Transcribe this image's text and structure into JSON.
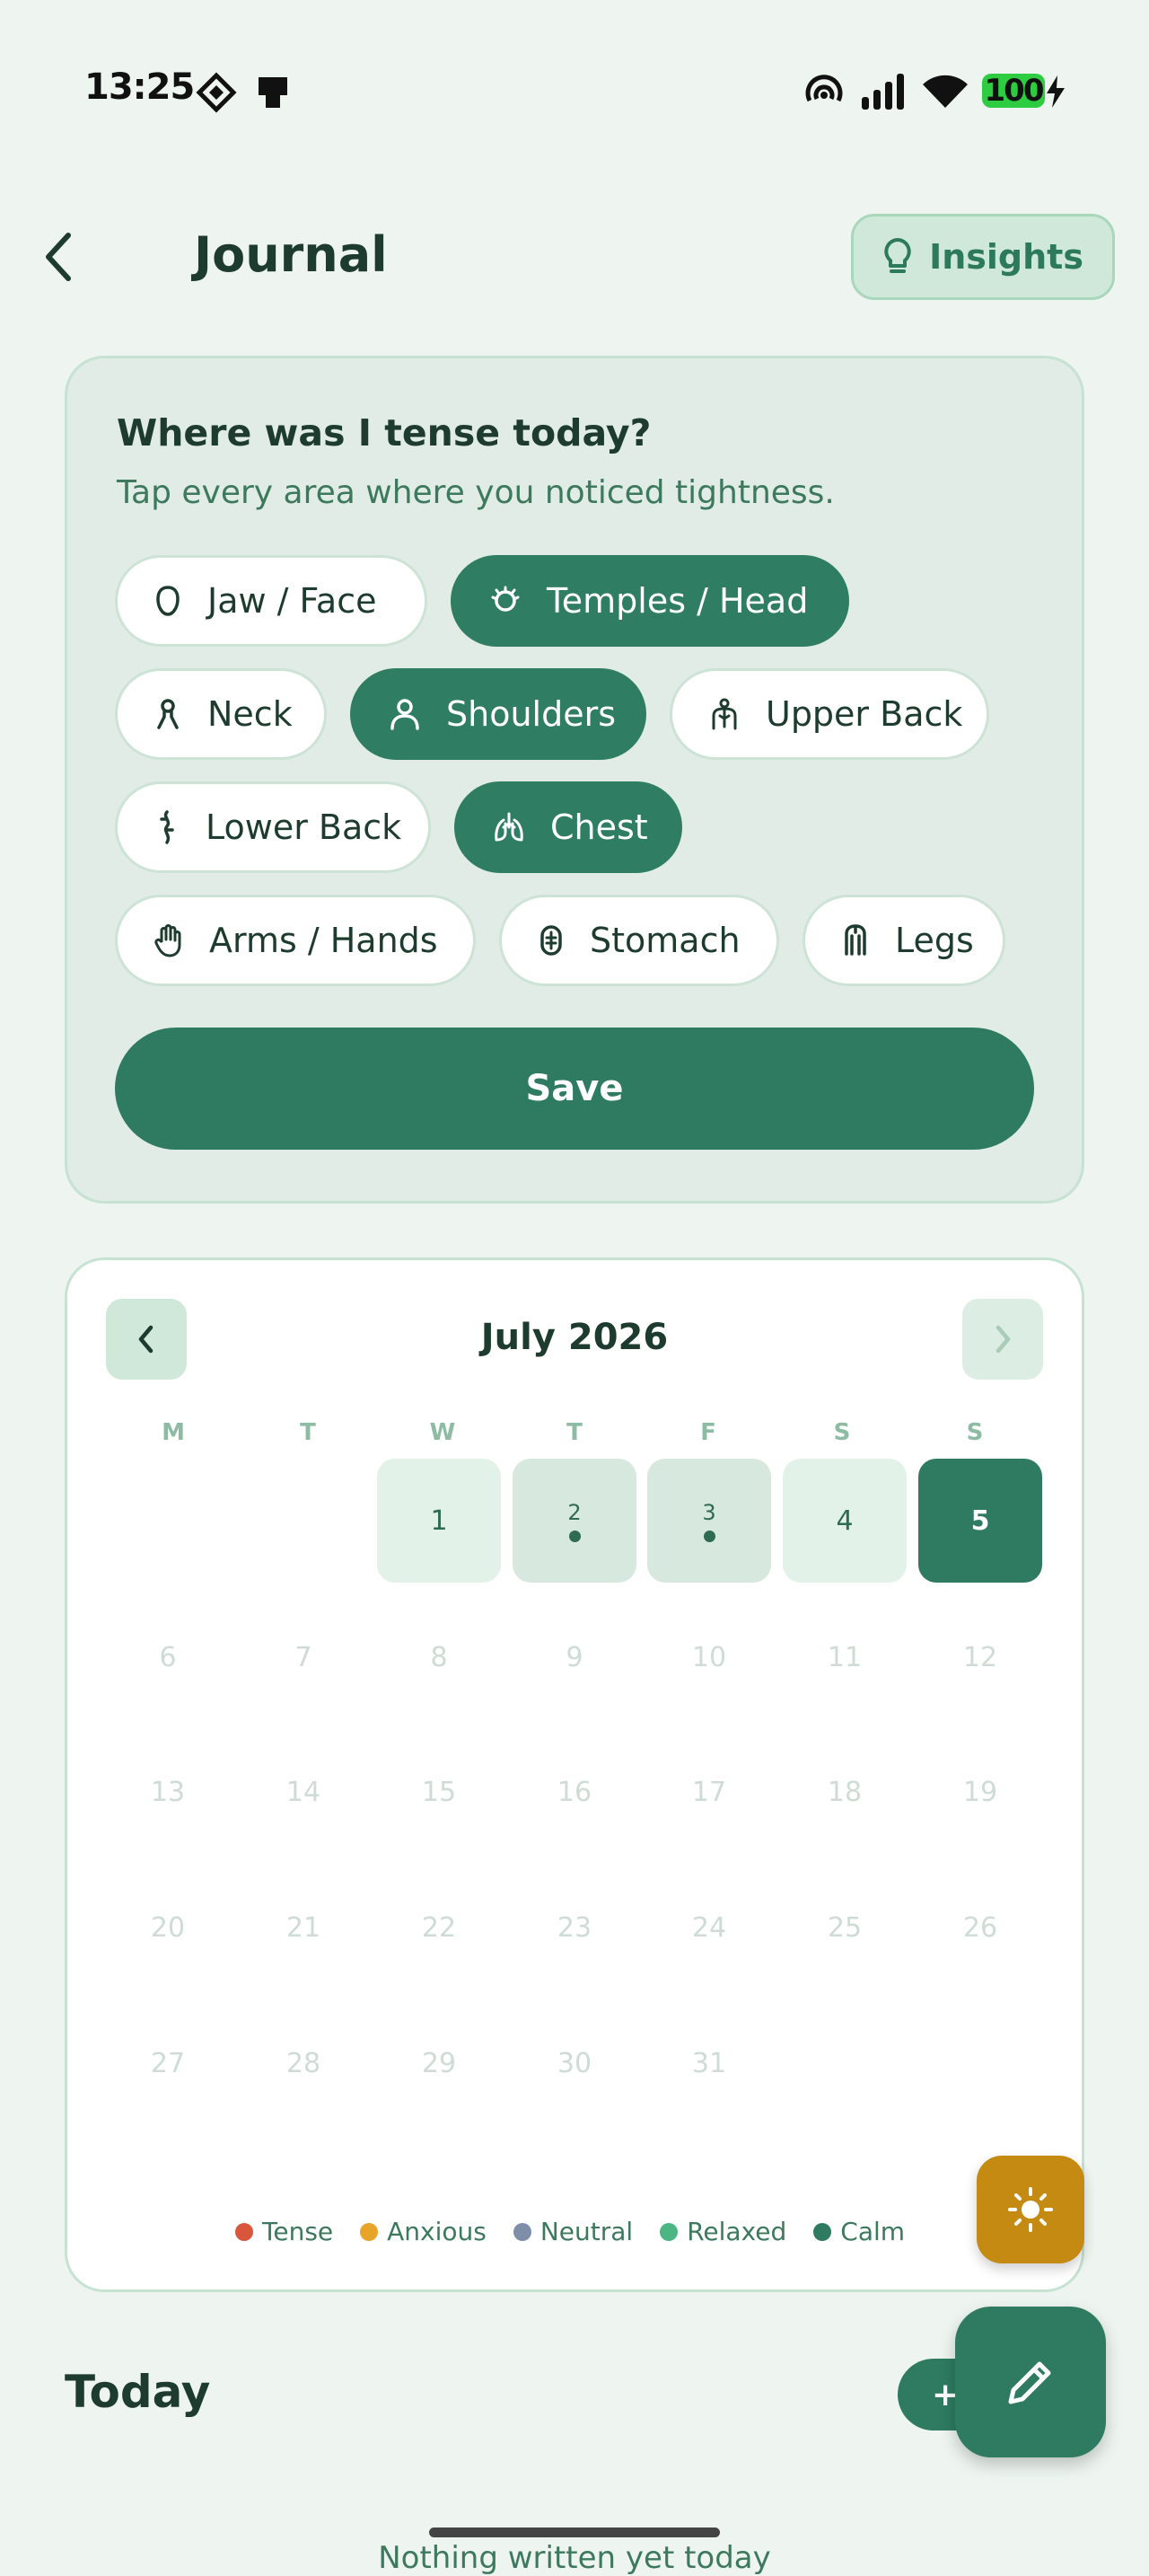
{
  "status_bar": {
    "time": "13:25",
    "battery": "100"
  },
  "header": {
    "title": "Journal",
    "insights_label": "Insights"
  },
  "tense_card": {
    "title": "Where was I tense today?",
    "subtitle": "Tap every area where you noticed tightness.",
    "chips": [
      {
        "label": "Jaw / Face",
        "selected": false,
        "icon": "face-icon"
      },
      {
        "label": "Temples / Head",
        "selected": true,
        "icon": "head-icon"
      },
      {
        "label": "Neck",
        "selected": false,
        "icon": "neck-icon"
      },
      {
        "label": "Shoulders",
        "selected": true,
        "icon": "shoulders-icon"
      },
      {
        "label": "Upper Back",
        "selected": false,
        "icon": "upper-back-icon"
      },
      {
        "label": "Lower Back",
        "selected": false,
        "icon": "spine-icon"
      },
      {
        "label": "Chest",
        "selected": true,
        "icon": "lungs-icon"
      },
      {
        "label": "Arms / Hands",
        "selected": false,
        "icon": "hand-icon"
      },
      {
        "label": "Stomach",
        "selected": false,
        "icon": "stomach-icon"
      },
      {
        "label": "Legs",
        "selected": false,
        "icon": "legs-icon"
      }
    ],
    "save_label": "Save"
  },
  "calendar": {
    "month_label": "July 2026",
    "weekdays": [
      "M",
      "T",
      "W",
      "T",
      "F",
      "S",
      "S"
    ],
    "days": [
      "1",
      "2",
      "3",
      "4",
      "5",
      "6",
      "7",
      "8",
      "9",
      "10",
      "11",
      "12",
      "13",
      "14",
      "15",
      "16",
      "17",
      "18",
      "19",
      "20",
      "21",
      "22",
      "23",
      "24",
      "25",
      "26",
      "27",
      "28",
      "29",
      "30",
      "31"
    ],
    "today": "5",
    "legend": [
      {
        "label": "Tense",
        "color": "#d9553b"
      },
      {
        "label": "Anxious",
        "color": "#e8a427"
      },
      {
        "label": "Neutral",
        "color": "#7f8ea8"
      },
      {
        "label": "Relaxed",
        "color": "#4cb584"
      },
      {
        "label": "Calm",
        "color": "#2e7b62"
      }
    ]
  },
  "today_section": {
    "title": "Today",
    "add_label": "+",
    "empty_text": "Nothing written yet today"
  }
}
